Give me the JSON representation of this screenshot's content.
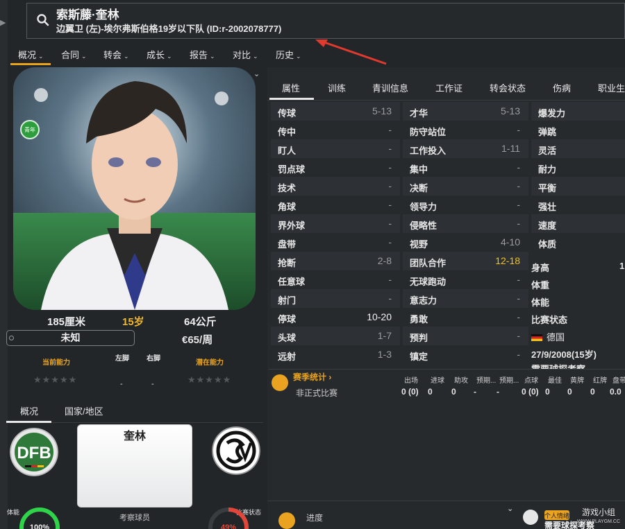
{
  "player": {
    "name": "索斯藤·奎林",
    "subtitle": "边翼卫 (左)-埃尔弗斯伯格19岁以下队 (ID:r-2002078777)",
    "youth_badge": "青年",
    "height": "185厘米",
    "age": "15岁",
    "weight": "64公斤",
    "position_box": "未知",
    "wage": "€65/周",
    "current_ability_label": "当前能力",
    "left_foot_label": "左脚",
    "right_foot_label": "右脚",
    "potential_ability_label": "潜在能力",
    "left_foot_value": "-",
    "right_foot_value": "-"
  },
  "nav": [
    {
      "label": "概况"
    },
    {
      "label": "合同"
    },
    {
      "label": "转会"
    },
    {
      "label": "成长"
    },
    {
      "label": "报告"
    },
    {
      "label": "对比"
    },
    {
      "label": "历史"
    }
  ],
  "lower_tabs": [
    {
      "label": "概况"
    },
    {
      "label": "国家/地区"
    }
  ],
  "card": {
    "name": "奎林",
    "scout_label": "考察球员"
  },
  "rings": {
    "fitness_label": "体能",
    "fitness_value": "100%",
    "fitness_fraction": 1.0,
    "match_label": "比赛状态",
    "match_value": "49%",
    "match_fraction": 0.49
  },
  "right_tabs": [
    {
      "label": "属性"
    },
    {
      "label": "训练"
    },
    {
      "label": "青训信息"
    },
    {
      "label": "工作证"
    },
    {
      "label": "转会状态"
    },
    {
      "label": "伤病"
    },
    {
      "label": "职业生"
    }
  ],
  "attributes": {
    "technical": [
      {
        "name": "传球",
        "value": "5-13"
      },
      {
        "name": "传中",
        "value": "-"
      },
      {
        "name": "盯人",
        "value": "-"
      },
      {
        "name": "罚点球",
        "value": "-"
      },
      {
        "name": "技术",
        "value": "-"
      },
      {
        "name": "角球",
        "value": "-"
      },
      {
        "name": "界外球",
        "value": "-"
      },
      {
        "name": "盘带",
        "value": "-"
      },
      {
        "name": "抢断",
        "value": "2-8"
      },
      {
        "name": "任意球",
        "value": "-"
      },
      {
        "name": "射门",
        "value": "-"
      },
      {
        "name": "停球",
        "value": "10-20"
      },
      {
        "name": "头球",
        "value": "1-7"
      },
      {
        "name": "远射",
        "value": "1-3"
      }
    ],
    "mental": [
      {
        "name": "才华",
        "value": "5-13"
      },
      {
        "name": "防守站位",
        "value": "-"
      },
      {
        "name": "工作投入",
        "value": "1-11"
      },
      {
        "name": "集中",
        "value": "-"
      },
      {
        "name": "决断",
        "value": "-"
      },
      {
        "name": "领导力",
        "value": "-"
      },
      {
        "name": "侵略性",
        "value": "-"
      },
      {
        "name": "视野",
        "value": "4-10"
      },
      {
        "name": "团队合作",
        "value": "12-18"
      },
      {
        "name": "无球跑动",
        "value": "-"
      },
      {
        "name": "意志力",
        "value": "-"
      },
      {
        "name": "勇敢",
        "value": "-"
      },
      {
        "name": "预判",
        "value": "-"
      },
      {
        "name": "镇定",
        "value": "-"
      }
    ],
    "physical": [
      {
        "name": "爆发力"
      },
      {
        "name": "弹跳"
      },
      {
        "name": "灵活"
      },
      {
        "name": "耐力"
      },
      {
        "name": "平衡"
      },
      {
        "name": "强壮"
      },
      {
        "name": "速度"
      },
      {
        "name": "体质"
      }
    ]
  },
  "bio": {
    "height_label": "身高",
    "height_value_partial": "1",
    "weight_label": "体重",
    "fitness_label": "体能",
    "matchstate_label": "比赛状态",
    "nation": "德国",
    "dob": "27/9/2008(15岁)",
    "partial_line": "需要球探考察"
  },
  "season": {
    "title": "赛季统计 ›",
    "headers": [
      "出场",
      "进球",
      "助攻",
      "预期...",
      "预期...",
      "点球",
      "最佳",
      "黄牌",
      "红牌",
      "盘带"
    ],
    "row_label": "非正式比赛",
    "row_values": [
      "0 (0)",
      "0",
      "0",
      "-",
      "-",
      "0 (0)",
      "0",
      "0",
      "0",
      "0.0"
    ]
  },
  "bottom": {
    "progress_label": "进度",
    "watermark_badge": "个人情绪",
    "watermark_text": "需要球探考察",
    "watermark_site": "WWW.PLAYGM.CC",
    "watermark_logo": "游戏小组"
  },
  "colors": {
    "accent": "#e8a21a",
    "highlight_value": "#f2c21b",
    "panel_bg": "#272a2d",
    "app_bg": "#232629"
  }
}
